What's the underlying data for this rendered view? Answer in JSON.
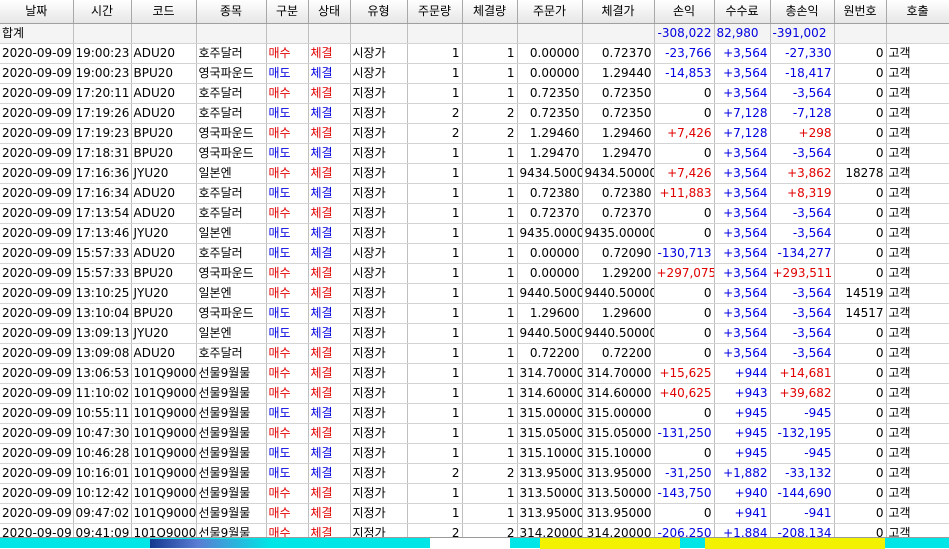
{
  "columns": [
    "날짜",
    "시간",
    "코드",
    "종목",
    "구분",
    "상태",
    "유형",
    "주문량",
    "체결량",
    "주문가",
    "체결가",
    "손익",
    "수수료",
    "총손익",
    "원번호",
    "호출"
  ],
  "summary": {
    "label": "합계",
    "pnl": "-308,022",
    "fee": "82,980",
    "total": "-391,002"
  },
  "rows": [
    [
      "2020-09-09",
      "19:00:23",
      "ADU20",
      "호주달러",
      "매수",
      "체결",
      "시장가",
      "1",
      "1",
      "0.00000",
      "0.72370",
      "-23,766",
      "+3,564",
      "-27,330",
      "0",
      "고객"
    ],
    [
      "2020-09-09",
      "19:00:23",
      "BPU20",
      "영국파운드",
      "매도",
      "체결",
      "시장가",
      "1",
      "1",
      "0.00000",
      "1.29440",
      "-14,853",
      "+3,564",
      "-18,417",
      "0",
      "고객"
    ],
    [
      "2020-09-09",
      "17:20:11",
      "ADU20",
      "호주달러",
      "매수",
      "체결",
      "지정가",
      "1",
      "1",
      "0.72350",
      "0.72350",
      "0",
      "+3,564",
      "-3,564",
      "0",
      "고객"
    ],
    [
      "2020-09-09",
      "17:19:26",
      "ADU20",
      "호주달러",
      "매도",
      "체결",
      "지정가",
      "2",
      "2",
      "0.72350",
      "0.72350",
      "0",
      "+7,128",
      "-7,128",
      "0",
      "고객"
    ],
    [
      "2020-09-09",
      "17:19:23",
      "BPU20",
      "영국파운드",
      "매수",
      "체결",
      "지정가",
      "2",
      "2",
      "1.29460",
      "1.29460",
      "+7,426",
      "+7,128",
      "+298",
      "0",
      "고객"
    ],
    [
      "2020-09-09",
      "17:18:31",
      "BPU20",
      "영국파운드",
      "매도",
      "체결",
      "지정가",
      "1",
      "1",
      "1.29470",
      "1.29470",
      "0",
      "+3,564",
      "-3,564",
      "0",
      "고객"
    ],
    [
      "2020-09-09",
      "17:16:36",
      "JYU20",
      "일본엔",
      "매수",
      "체결",
      "지정가",
      "1",
      "1",
      "9434.50000",
      "9434.50000",
      "+7,426",
      "+3,564",
      "+3,862",
      "18278",
      "고객"
    ],
    [
      "2020-09-09",
      "17:16:34",
      "ADU20",
      "호주달러",
      "매도",
      "체결",
      "지정가",
      "1",
      "1",
      "0.72380",
      "0.72380",
      "+11,883",
      "+3,564",
      "+8,319",
      "0",
      "고객"
    ],
    [
      "2020-09-09",
      "17:13:54",
      "ADU20",
      "호주달러",
      "매수",
      "체결",
      "지정가",
      "1",
      "1",
      "0.72370",
      "0.72370",
      "0",
      "+3,564",
      "-3,564",
      "0",
      "고객"
    ],
    [
      "2020-09-09",
      "17:13:46",
      "JYU20",
      "일본엔",
      "매도",
      "체결",
      "지정가",
      "1",
      "1",
      "9435.00000",
      "9435.00000",
      "0",
      "+3,564",
      "-3,564",
      "0",
      "고객"
    ],
    [
      "2020-09-09",
      "15:57:33",
      "ADU20",
      "호주달러",
      "매도",
      "체결",
      "시장가",
      "1",
      "1",
      "0.00000",
      "0.72090",
      "-130,713",
      "+3,564",
      "-134,277",
      "0",
      "고객"
    ],
    [
      "2020-09-09",
      "15:57:33",
      "BPU20",
      "영국파운드",
      "매수",
      "체결",
      "시장가",
      "1",
      "1",
      "0.00000",
      "1.29200",
      "+297,075",
      "+3,564",
      "+293,511",
      "0",
      "고객"
    ],
    [
      "2020-09-09",
      "13:10:25",
      "JYU20",
      "일본엔",
      "매수",
      "체결",
      "지정가",
      "1",
      "1",
      "9440.50000",
      "9440.50000",
      "0",
      "+3,564",
      "-3,564",
      "14519",
      "고객"
    ],
    [
      "2020-09-09",
      "13:10:04",
      "BPU20",
      "영국파운드",
      "매도",
      "체결",
      "지정가",
      "1",
      "1",
      "1.29600",
      "1.29600",
      "0",
      "+3,564",
      "-3,564",
      "14517",
      "고객"
    ],
    [
      "2020-09-09",
      "13:09:13",
      "JYU20",
      "일본엔",
      "매도",
      "체결",
      "지정가",
      "1",
      "1",
      "9440.50000",
      "9440.50000",
      "0",
      "+3,564",
      "-3,564",
      "0",
      "고객"
    ],
    [
      "2020-09-09",
      "13:09:08",
      "ADU20",
      "호주달러",
      "매수",
      "체결",
      "지정가",
      "1",
      "1",
      "0.72200",
      "0.72200",
      "0",
      "+3,564",
      "-3,564",
      "0",
      "고객"
    ],
    [
      "2020-09-09",
      "13:06:53",
      "101Q9000",
      "선물9월물",
      "매수",
      "체결",
      "지정가",
      "1",
      "1",
      "314.70000",
      "314.70000",
      "+15,625",
      "+944",
      "+14,681",
      "0",
      "고객"
    ],
    [
      "2020-09-09",
      "11:10:02",
      "101Q9000",
      "선물9월물",
      "매수",
      "체결",
      "지정가",
      "1",
      "1",
      "314.60000",
      "314.60000",
      "+40,625",
      "+943",
      "+39,682",
      "0",
      "고객"
    ],
    [
      "2020-09-09",
      "10:55:11",
      "101Q9000",
      "선물9월물",
      "매도",
      "체결",
      "지정가",
      "1",
      "1",
      "315.00000",
      "315.00000",
      "0",
      "+945",
      "-945",
      "0",
      "고객"
    ],
    [
      "2020-09-09",
      "10:47:30",
      "101Q9000",
      "선물9월물",
      "매수",
      "체결",
      "지정가",
      "1",
      "1",
      "315.05000",
      "315.05000",
      "-131,250",
      "+945",
      "-132,195",
      "0",
      "고객"
    ],
    [
      "2020-09-09",
      "10:46:28",
      "101Q9000",
      "선물9월물",
      "매도",
      "체결",
      "지정가",
      "1",
      "1",
      "315.10000",
      "315.10000",
      "0",
      "+945",
      "-945",
      "0",
      "고객"
    ],
    [
      "2020-09-09",
      "10:16:01",
      "101Q9000",
      "선물9월물",
      "매도",
      "체결",
      "지정가",
      "2",
      "2",
      "313.95000",
      "313.95000",
      "-31,250",
      "+1,882",
      "-33,132",
      "0",
      "고객"
    ],
    [
      "2020-09-09",
      "10:12:42",
      "101Q9000",
      "선물9월물",
      "매수",
      "체결",
      "지정가",
      "1",
      "1",
      "313.50000",
      "313.50000",
      "-143,750",
      "+940",
      "-144,690",
      "0",
      "고객"
    ],
    [
      "2020-09-09",
      "09:47:02",
      "101Q9000",
      "선물9월물",
      "매수",
      "체결",
      "지정가",
      "1",
      "1",
      "313.95000",
      "313.95000",
      "0",
      "+941",
      "-941",
      "0",
      "고객"
    ],
    [
      "2020-09-09",
      "09:41:09",
      "101Q9000",
      "선물9월물",
      "매수",
      "체결",
      "지정가",
      "2",
      "2",
      "314.20000",
      "314.20000",
      "-206,250",
      "+1,884",
      "-208,134",
      "0",
      "고객"
    ]
  ],
  "colors": {
    "buy": "#e00000",
    "sell": "#0000e0",
    "header_bg": "#ececec",
    "statusbar": "#00e5e5"
  }
}
